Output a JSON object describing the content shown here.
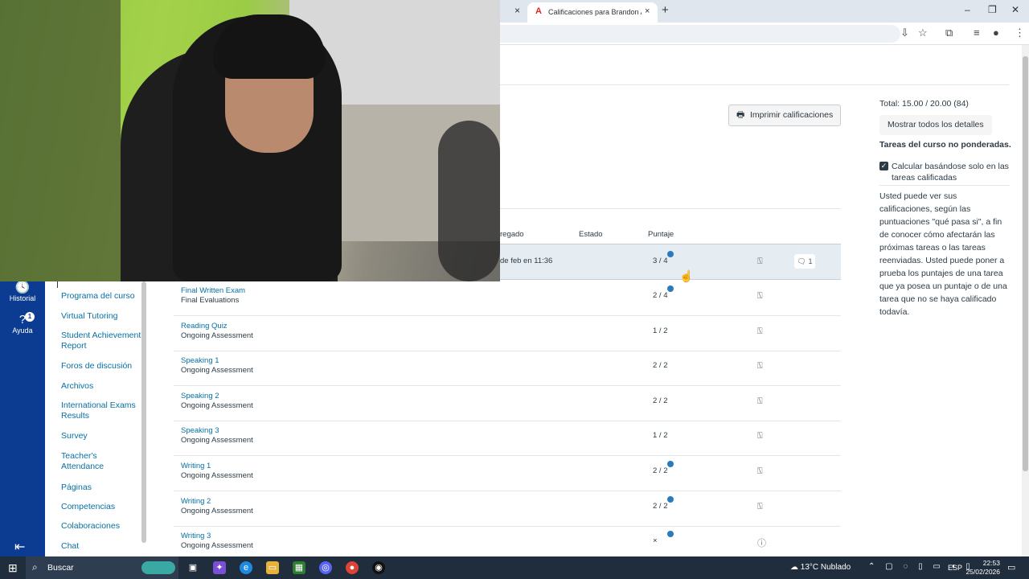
{
  "browser": {
    "tab_title": "Calificaciones para Brandon Ac",
    "tab_close": "×",
    "prev_tab_close": "×",
    "new_tab": "+",
    "window_buttons": [
      "–",
      "❐",
      "✕"
    ]
  },
  "global_nav": {
    "history_label": "Historial",
    "help_label": "Ayuda",
    "help_badge": "1"
  },
  "course_nav": {
    "items": [
      "Programa del curso",
      "Virtual Tutoring",
      "Student Achievement Report",
      "Foros de discusión",
      "Archivos",
      "International Exams Results",
      "Survey",
      "Teacher's Attendance",
      "Páginas",
      "Competencias",
      "Colaboraciones",
      "Chat"
    ]
  },
  "grades": {
    "print_button": "Imprimir calificaciones",
    "headers": {
      "submitted": "regado",
      "status": "Estado",
      "score": "Puntaje"
    },
    "highlighted_row": {
      "date": "de feb en 11:36",
      "score": "3 / 4",
      "comments": "1"
    },
    "rows": [
      {
        "name": "Final Written Exam",
        "group": "Final Evaluations",
        "score": "2 / 4",
        "what_if": true
      },
      {
        "name": "Reading Quiz",
        "group": "Ongoing Assessment",
        "score": "1 / 2",
        "what_if": false
      },
      {
        "name": "Speaking 1",
        "group": "Ongoing Assessment",
        "score": "2 / 2",
        "what_if": false
      },
      {
        "name": "Speaking 2",
        "group": "Ongoing Assessment",
        "score": "2 / 2",
        "what_if": false
      },
      {
        "name": "Speaking 3",
        "group": "Ongoing Assessment",
        "score": "1 / 2",
        "what_if": false
      },
      {
        "name": "Writing 1",
        "group": "Ongoing Assessment",
        "score": "2 / 2",
        "what_if": true
      },
      {
        "name": "Writing 2",
        "group": "Ongoing Assessment",
        "score": "2 / 2",
        "what_if": true
      },
      {
        "name": "Writing 3",
        "group": "Ongoing Assessment",
        "score": "×",
        "what_if": true
      }
    ]
  },
  "sidebar": {
    "total": "Total: 15.00 / 20.00 (84)",
    "details_button": "Mostrar todos los detalles",
    "unweighted": "Tareas del curso no ponderadas.",
    "calc_label": "Calcular basándose solo en las tareas calificadas",
    "calc_checked": true,
    "whatif_text": "Usted puede ver sus calificaciones, según las puntuaciones \"qué pasa si\", a fin de conocer cómo afectarán las próximas tareas o las tareas reenviadas. Usted puede poner a prueba los puntajes de una tarea que ya posea un puntaje o de una tarea que no se haya calificado todavía."
  },
  "taskbar": {
    "search_placeholder": "Buscar",
    "weather": "13°C Nublado",
    "language": "ESP",
    "time": "22:53",
    "date": "25/02/2026"
  },
  "colors": {
    "nav_bg": "#0b3c91",
    "link": "#0770a3",
    "whatif_dot": "#2b7abc",
    "highlight_row": "#e5edf3"
  }
}
